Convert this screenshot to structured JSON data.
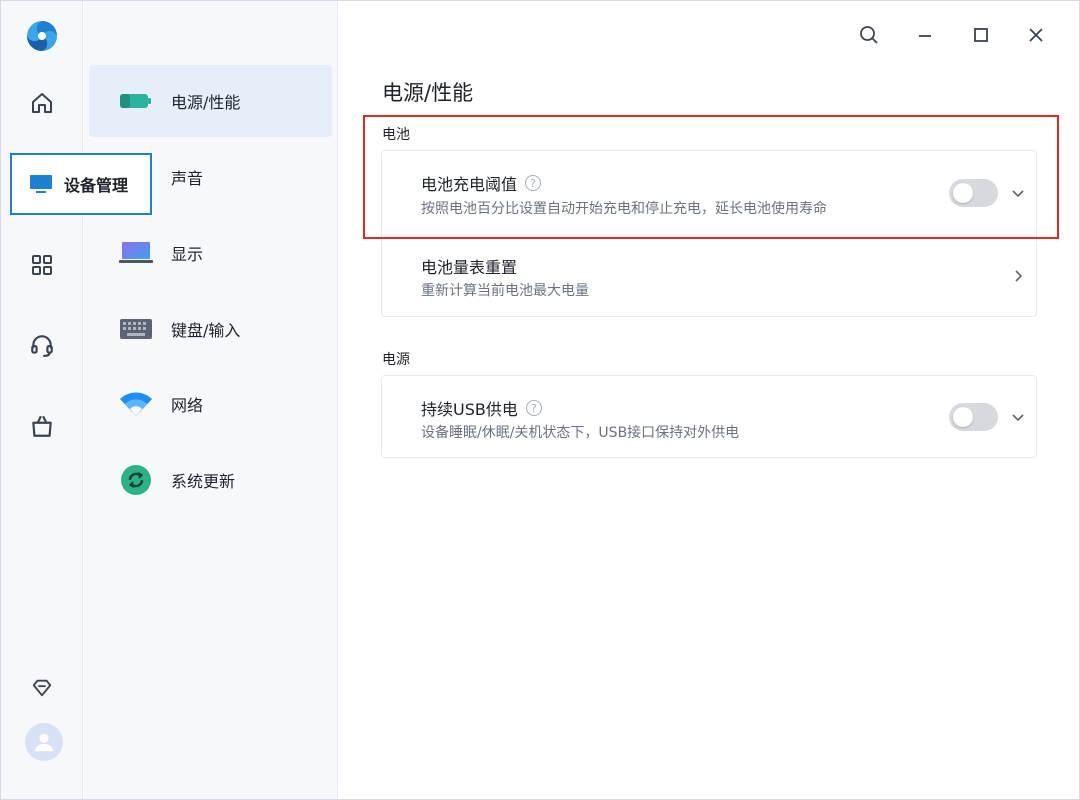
{
  "window": {
    "controls": [
      "search-icon",
      "minimize-icon",
      "maximize-icon",
      "close-icon"
    ]
  },
  "rail": {
    "items": [
      "home-icon",
      "device-icon",
      "apps-icon",
      "headset-icon",
      "store-icon"
    ],
    "device_management_label": "设备管理",
    "bottom": [
      "diamond-icon",
      "avatar-icon"
    ]
  },
  "subnav": {
    "items": [
      {
        "label": "电源/性能",
        "icon": "battery-icon",
        "active": true
      },
      {
        "label": "声音",
        "icon": "speaker-icon",
        "active": false
      },
      {
        "label": "显示",
        "icon": "laptop-icon",
        "active": false
      },
      {
        "label": "键盘/输入",
        "icon": "keyboard-icon",
        "active": false
      },
      {
        "label": "网络",
        "icon": "wifi-icon",
        "active": false
      },
      {
        "label": "系统更新",
        "icon": "update-icon",
        "active": false
      }
    ]
  },
  "main": {
    "title": "电源/性能",
    "battery_section": {
      "label": "电池",
      "charge_threshold": {
        "title": "电池充电阈值",
        "desc": "按照电池百分比设置自动开始充电和停止充电，延长电池使用寿命",
        "toggle_on": false
      },
      "gauge_reset": {
        "title": "电池量表重置",
        "desc": "重新计算当前电池最大电量"
      }
    },
    "power_section": {
      "label": "电源",
      "usb_power": {
        "title": "持续USB供电",
        "desc": "设备睡眠/休眠/关机状态下，USB接口保持对外供电",
        "toggle_on": false
      }
    },
    "help_glyph": "?"
  },
  "colors": {
    "accent": "#1f7fd1",
    "highlight_box": "#e02a2a",
    "active_nav_bg": "#e6eefa",
    "toggle_off": "#d6d9de"
  }
}
